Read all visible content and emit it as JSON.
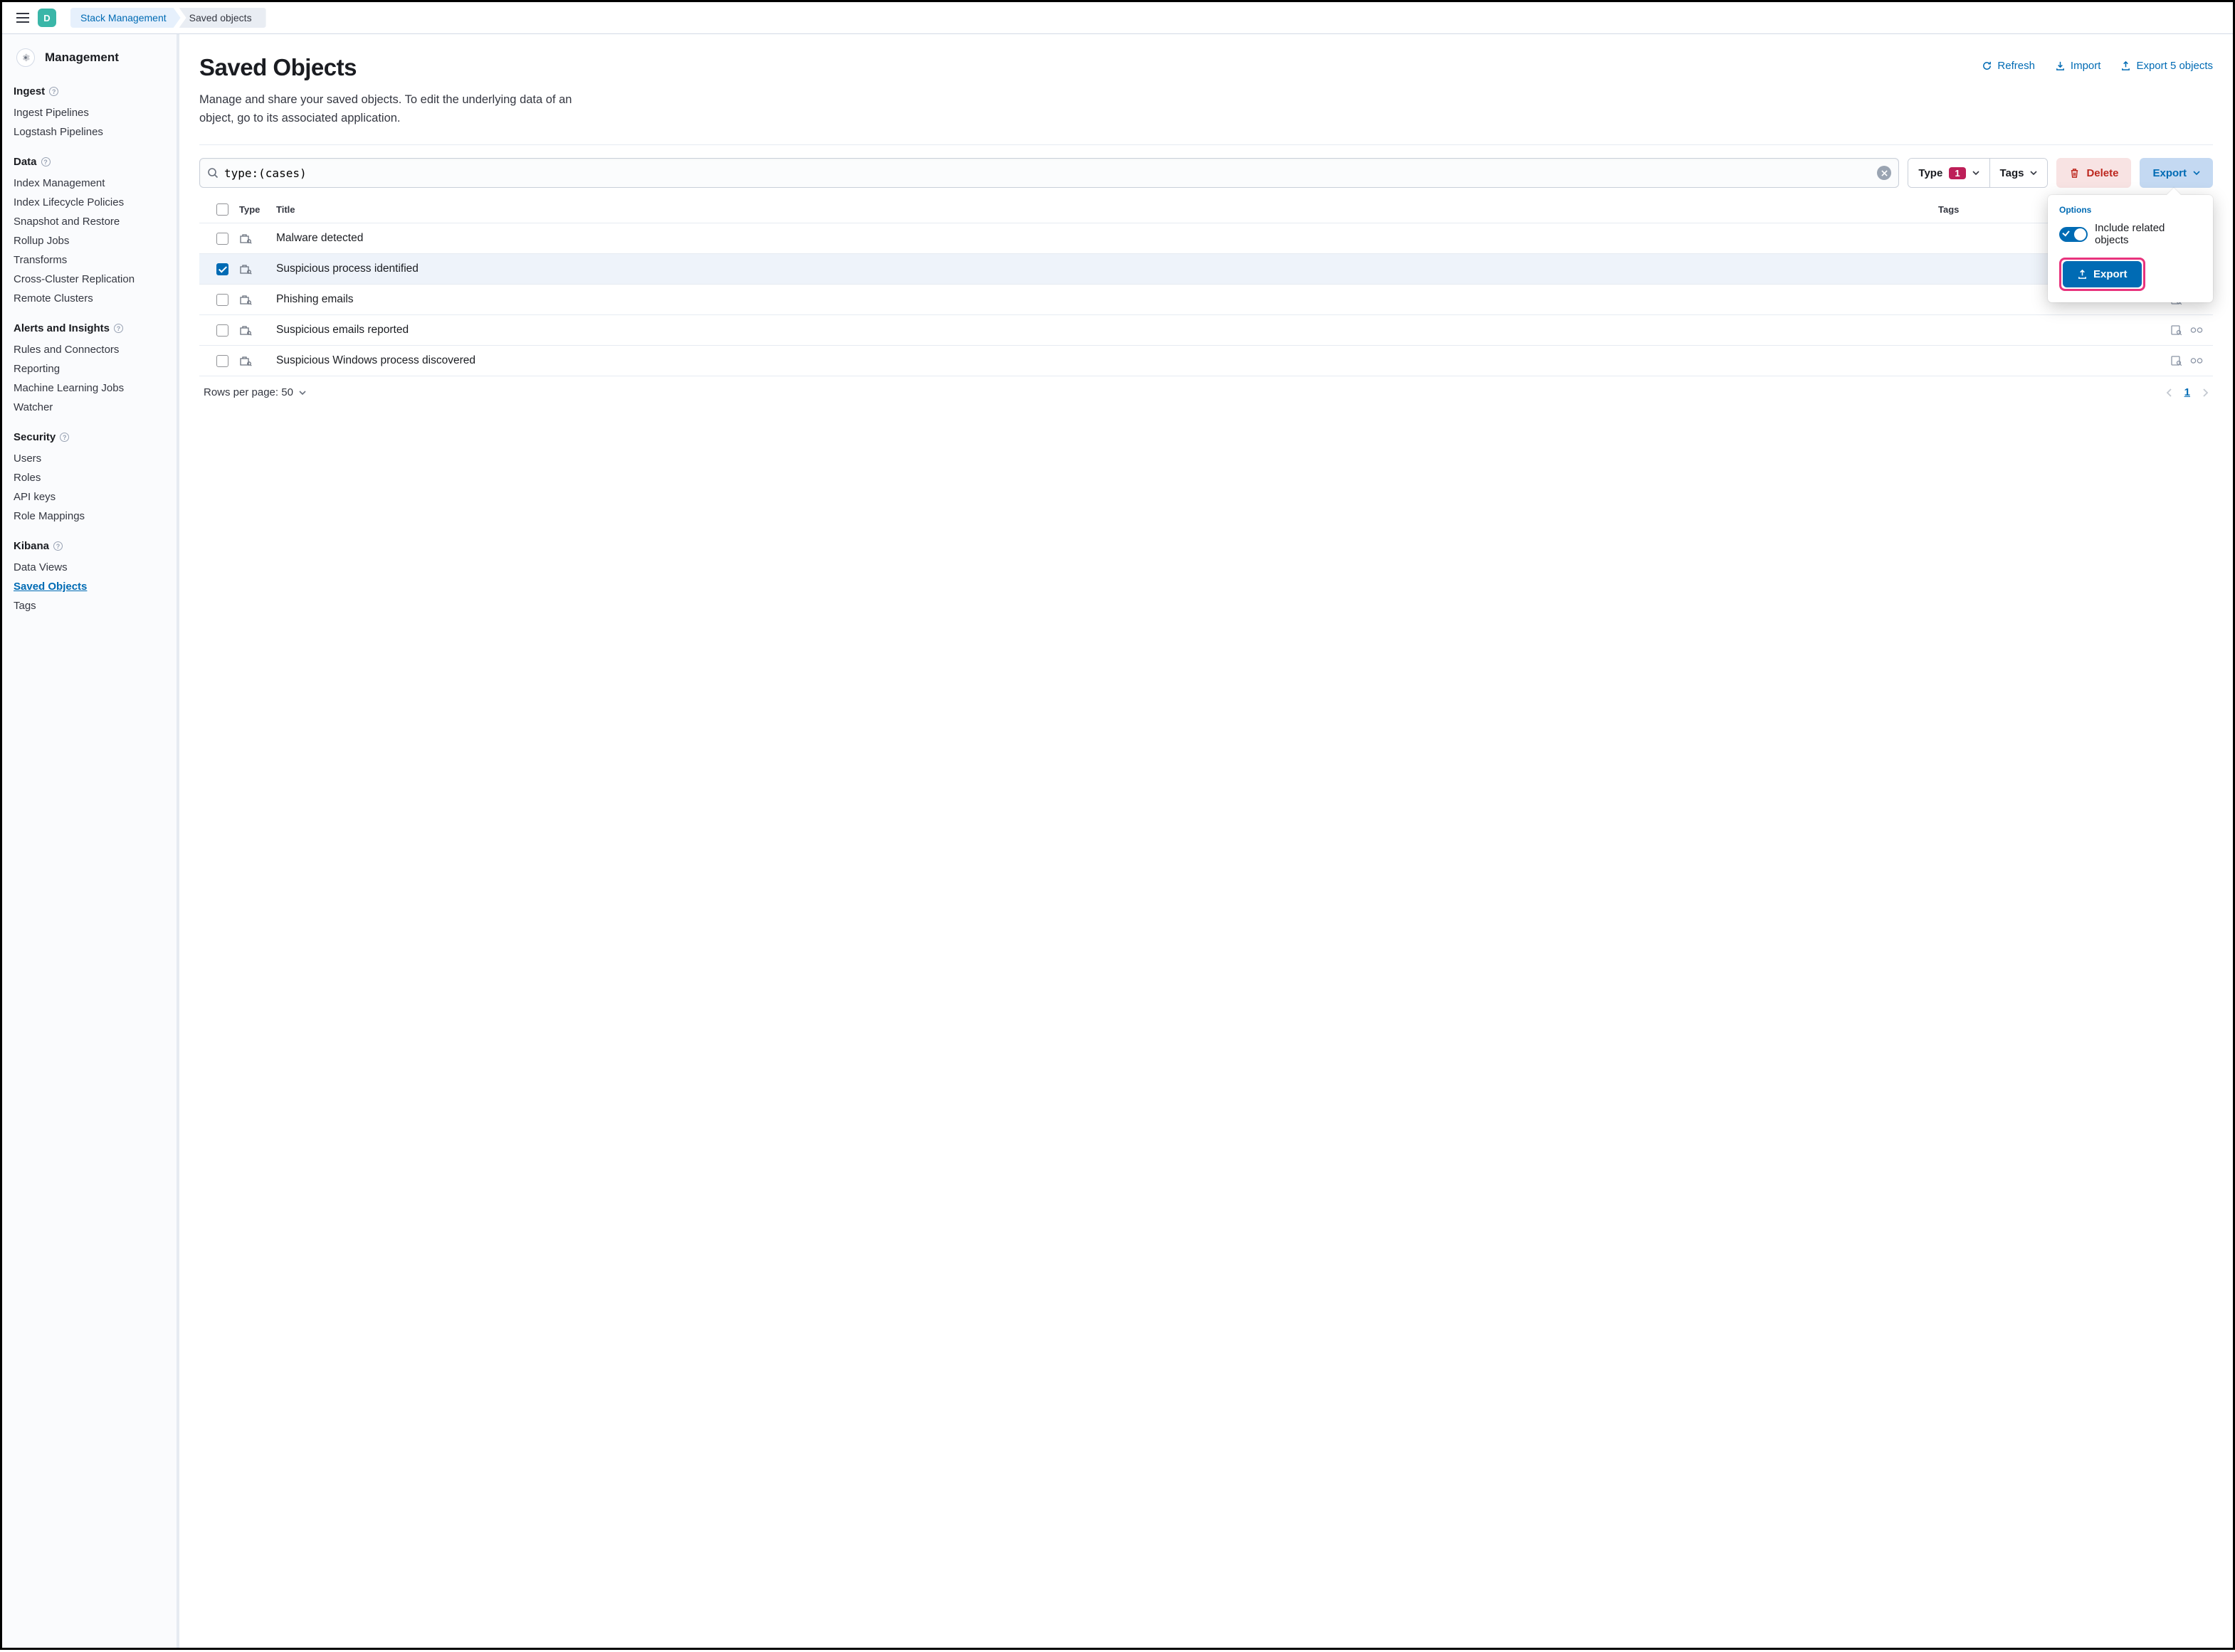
{
  "header": {
    "space_letter": "D",
    "breadcrumb": [
      "Stack Management",
      "Saved objects"
    ]
  },
  "sidebar": {
    "title": "Management",
    "groups": [
      {
        "title": "Ingest",
        "info": true,
        "items": [
          "Ingest Pipelines",
          "Logstash Pipelines"
        ]
      },
      {
        "title": "Data",
        "info": true,
        "items": [
          "Index Management",
          "Index Lifecycle Policies",
          "Snapshot and Restore",
          "Rollup Jobs",
          "Transforms",
          "Cross-Cluster Replication",
          "Remote Clusters"
        ]
      },
      {
        "title": "Alerts and Insights",
        "info": true,
        "items": [
          "Rules and Connectors",
          "Reporting",
          "Machine Learning Jobs",
          "Watcher"
        ]
      },
      {
        "title": "Security",
        "info": true,
        "items": [
          "Users",
          "Roles",
          "API keys",
          "Role Mappings"
        ]
      },
      {
        "title": "Kibana",
        "info": true,
        "items": [
          "Data Views",
          "Saved Objects",
          "Tags"
        ]
      }
    ],
    "active_item": "Saved Objects"
  },
  "main": {
    "title": "Saved Objects",
    "description": "Manage and share your saved objects. To edit the underlying data of an object, go to its associated application.",
    "actions": {
      "refresh": "Refresh",
      "import": "Import",
      "export": "Export 5 objects"
    }
  },
  "search": {
    "value": "type:(cases)"
  },
  "filters": {
    "type_label": "Type",
    "type_count": "1",
    "tags_label": "Tags"
  },
  "buttons": {
    "delete": "Delete",
    "export": "Export"
  },
  "popover": {
    "options_label": "Options",
    "switch_label": "Include related objects",
    "export_label": "Export"
  },
  "table": {
    "headers": {
      "type": "Type",
      "title": "Title",
      "tags": "Tags"
    },
    "rows": [
      {
        "title": "Malware detected",
        "checked": false
      },
      {
        "title": "Suspicious process identified",
        "checked": true
      },
      {
        "title": "Phishing emails",
        "checked": false
      },
      {
        "title": "Suspicious emails reported",
        "checked": false
      },
      {
        "title": "Suspicious Windows process discovered",
        "checked": false
      }
    ],
    "rows_per_page_label": "Rows per page: 50",
    "current_page": "1"
  }
}
